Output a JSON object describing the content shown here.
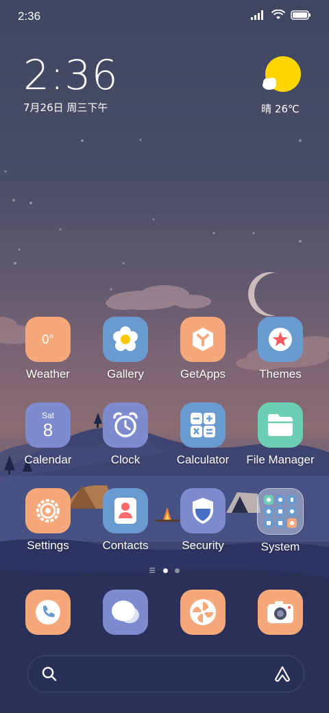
{
  "status_bar": {
    "time": "2:36"
  },
  "clock_widget": {
    "time": "2:36",
    "date": "7月26日 周三下午"
  },
  "weather_widget": {
    "condition_temp": "晴 26℃"
  },
  "apps": {
    "weather": {
      "label": "Weather",
      "icon_text": "0°"
    },
    "gallery": {
      "label": "Gallery"
    },
    "getapps": {
      "label": "GetApps"
    },
    "themes": {
      "label": "Themes"
    },
    "calendar": {
      "label": "Calendar",
      "day": "Sat",
      "date": "8"
    },
    "clock": {
      "label": "Clock"
    },
    "calculator": {
      "label": "Calculator"
    },
    "file_manager": {
      "label": "File Manager"
    },
    "settings": {
      "label": "Settings"
    },
    "contacts": {
      "label": "Contacts"
    },
    "security": {
      "label": "Security"
    },
    "system": {
      "label": "System"
    }
  },
  "page_indicator": {
    "pages": 2,
    "current": 1
  },
  "dock": [
    "phone-icon",
    "messages-icon",
    "browser-icon",
    "camera-icon"
  ],
  "colors": {
    "orange": "#f5a87a",
    "blue": "#6a9bd0",
    "purple": "#7f8bcf",
    "teal": "#6ccfb2"
  }
}
